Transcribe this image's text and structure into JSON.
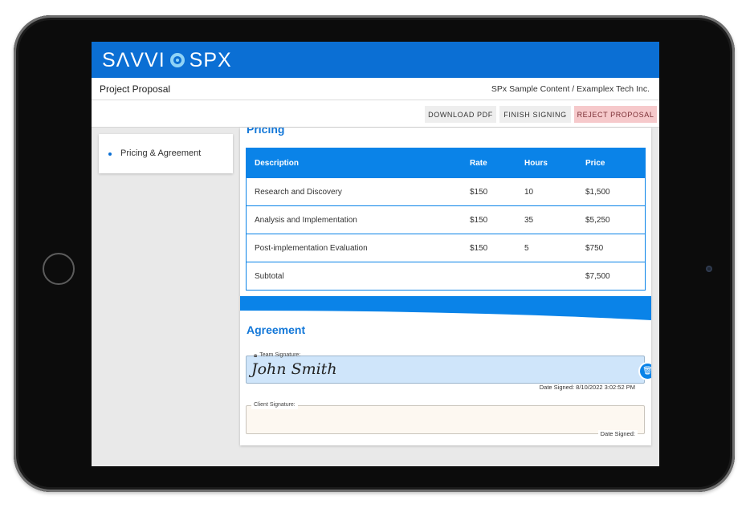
{
  "brand": {
    "logo_left": "SΛVVI",
    "logo_right": "SPX",
    "color": "#0b6fd4"
  },
  "titlebar": {
    "title": "Project Proposal",
    "context": "SPx Sample Content / Examplex Tech Inc."
  },
  "actions": {
    "download": "DOWNLOAD PDF",
    "finish": "FINISH SIGNING",
    "reject": "REJECT PROPOSAL"
  },
  "sidebar": {
    "items": [
      {
        "label": "Pricing & Agreement"
      }
    ]
  },
  "pricing": {
    "heading": "Pricing",
    "columns": [
      "Description",
      "Rate",
      "Hours",
      "Price"
    ],
    "rows": [
      [
        "Research and Discovery",
        "$150",
        "10",
        "$1,500"
      ],
      [
        "Analysis and Implementation",
        "$150",
        "35",
        "$5,250"
      ],
      [
        "Post-implementation Evaluation",
        "$150",
        "5",
        "$750"
      ]
    ],
    "subtotal_label": "Subtotal",
    "subtotal_value": "$7,500"
  },
  "agreement": {
    "heading": "Agreement",
    "team": {
      "label": "Team Signature:",
      "name": "John Smith",
      "date": "Date Signed: 8/10/2022 3:02:52 PM"
    },
    "client": {
      "label": "Client Signature:",
      "date": "Date Signed:"
    }
  },
  "icons": {
    "lock": "lock-icon",
    "trash": "trash-icon"
  }
}
